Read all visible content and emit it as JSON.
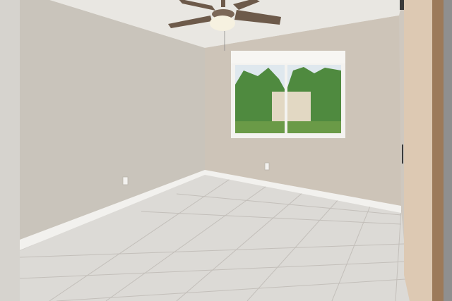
{
  "scene": {
    "description_elements": [
      "ceiling",
      "left-wall",
      "back-wall",
      "tile-floor",
      "window",
      "ceiling-fan",
      "barn-door",
      "baseboards",
      "outlets"
    ]
  },
  "colors": {
    "ceiling": "#e9e7e2",
    "left_wall": "#c9c4bb",
    "back_wall": "#cdc4b8",
    "floor": "#dcdad6",
    "grout": "#c3bfba",
    "baseboard": "#f2f1ee",
    "window_frame": "#f4f3f0",
    "sky": "#dfe8ee",
    "foliage": "#4f8a3f",
    "door": "#ddc9b3",
    "door_edge": "#9c7a5a",
    "fan_blade": "#6d5a4a",
    "fan_light": "#f6f1e0"
  }
}
